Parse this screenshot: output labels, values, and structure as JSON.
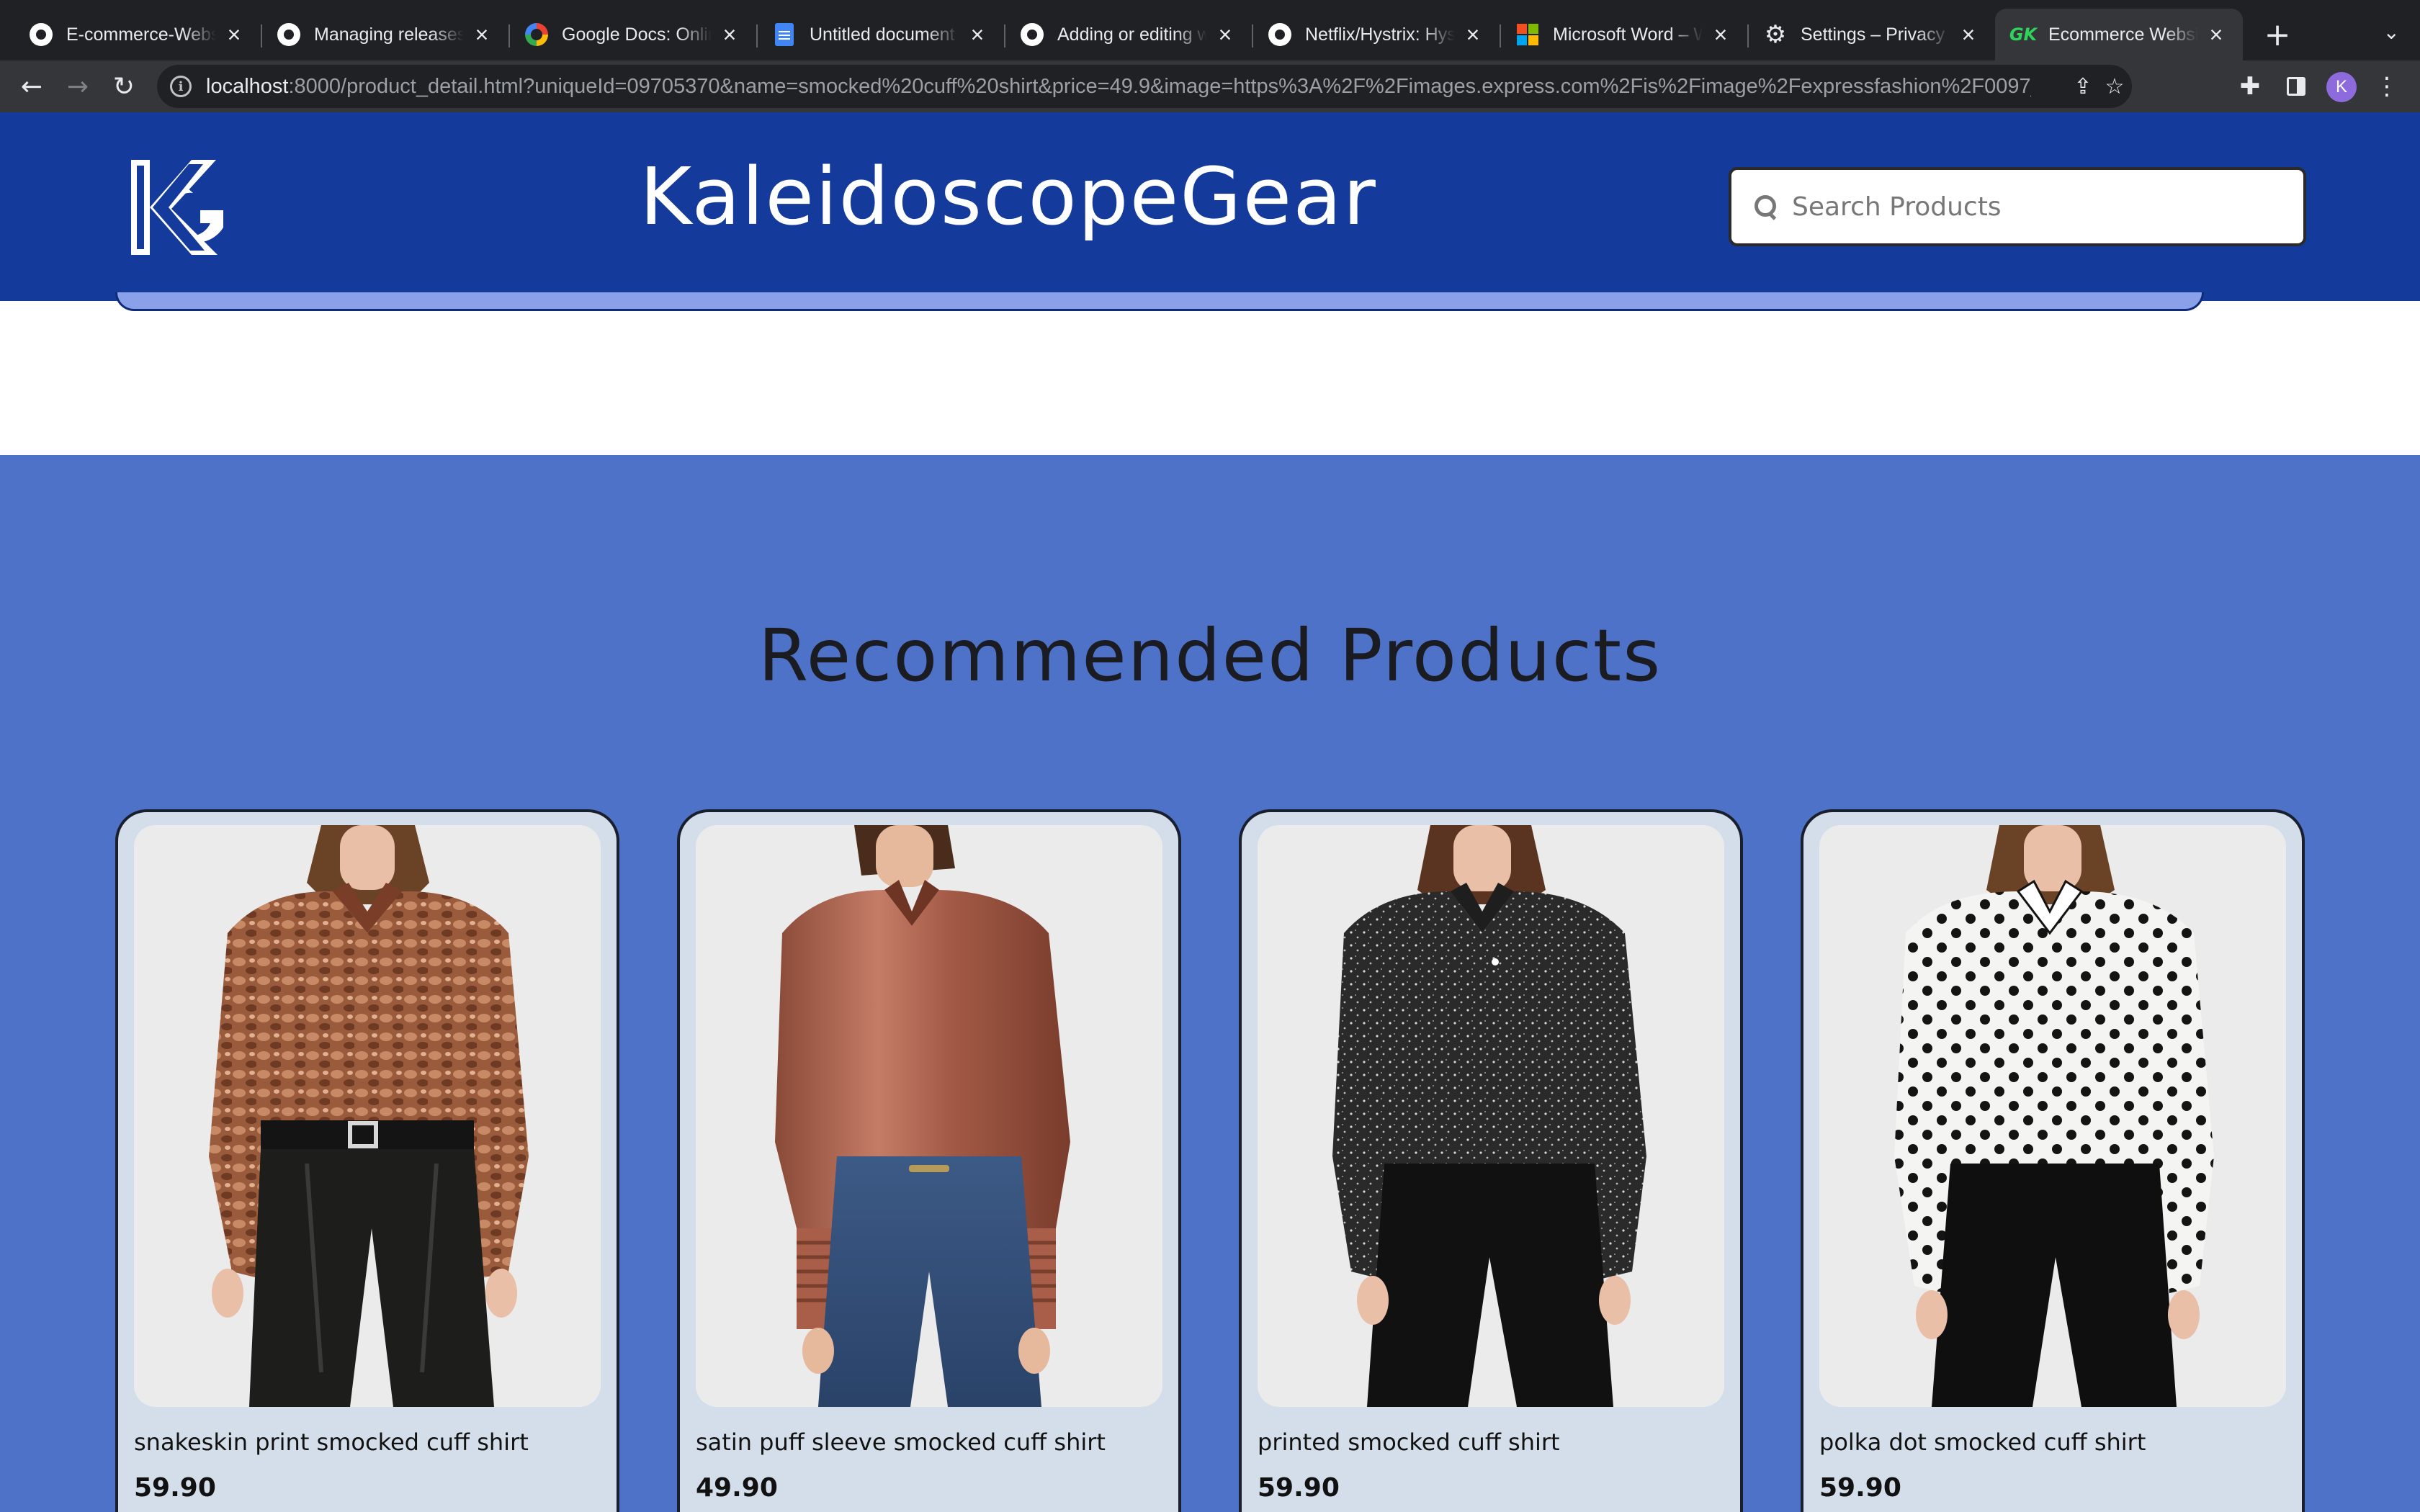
{
  "browser": {
    "tabs": [
      {
        "title": "E-commerce-Website",
        "icon": "github-icon",
        "active": false
      },
      {
        "title": "Managing releases",
        "icon": "github-icon",
        "active": false
      },
      {
        "title": "Google Docs: Online",
        "icon": "google-icon",
        "active": false
      },
      {
        "title": "Untitled document",
        "icon": "docs-icon",
        "active": false
      },
      {
        "title": "Adding or editing wikis",
        "icon": "github-icon",
        "active": false
      },
      {
        "title": "Netflix/Hystrix: Hystrix",
        "icon": "github-icon",
        "active": false
      },
      {
        "title": "Microsoft Word – Work",
        "icon": "microsoft-icon",
        "active": false
      },
      {
        "title": "Settings – Privacy and",
        "icon": "gear-icon",
        "active": false
      },
      {
        "title": "Ecommerce Website",
        "icon": "gk-icon",
        "active": true
      }
    ],
    "favicon_gk_text": "GK",
    "address": {
      "host": "localhost",
      "rest": ":8000/product_detail.html?uniqueId=09705370&name=smocked%20cuff%20shirt&price=49.9&image=https%3A%2F%2Fimages.express.com%2Fis%2Fimage%2Fexpressfashion%2F0097_..."
    },
    "profile_initial": "K"
  },
  "site": {
    "brand_name": "KaleidoscopeGear",
    "logo_text": "KG",
    "search": {
      "placeholder": "Search Products",
      "value": ""
    },
    "colors": {
      "header": "#143a9b",
      "section": "#4d72c8",
      "card": "#d4deea"
    }
  },
  "recommended": {
    "title": "Recommended Products",
    "products": [
      {
        "name": "snakeskin print smocked cuff shirt",
        "price": "59.90",
        "image": "snakeskin-shirt-photo"
      },
      {
        "name": "satin puff sleeve smocked cuff shirt",
        "price": "49.90",
        "image": "satin-shirt-photo"
      },
      {
        "name": "printed smocked cuff shirt",
        "price": "59.90",
        "image": "printed-shirt-photo"
      },
      {
        "name": "polka dot smocked cuff shirt",
        "price": "59.90",
        "image": "polka-dot-shirt-photo"
      }
    ]
  }
}
